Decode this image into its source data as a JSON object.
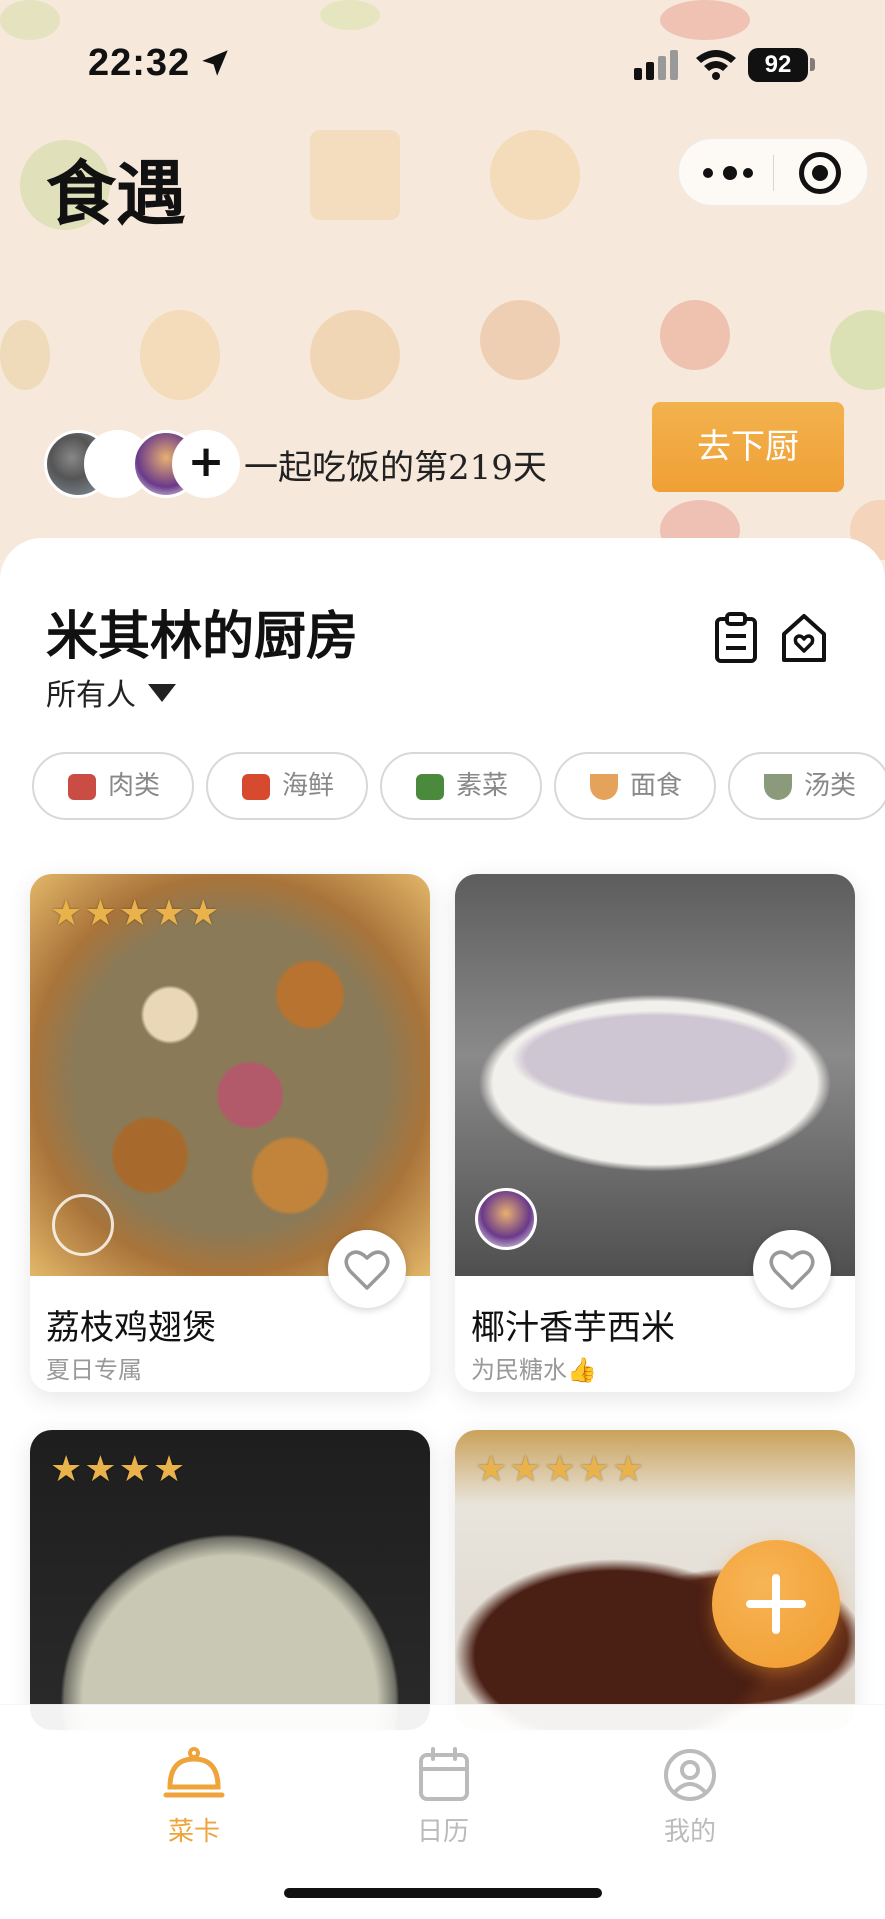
{
  "status_bar": {
    "time": "22:32",
    "battery": "92"
  },
  "app": {
    "title": "食遇"
  },
  "header": {
    "together_text": "一起吃饭的第219天",
    "cook_button": "去下厨"
  },
  "kitchen": {
    "title": "米其林的厨房",
    "owner_filter": "所有人"
  },
  "categories": [
    {
      "label": "肉类",
      "icon": "meat-icon",
      "color": "#c94d45"
    },
    {
      "label": "海鲜",
      "icon": "lobster-icon",
      "color": "#d64a2f"
    },
    {
      "label": "素菜",
      "icon": "leafy-greens-icon",
      "color": "#4b8a3c"
    },
    {
      "label": "面食",
      "icon": "noodle-bowl-icon",
      "color": "#e4a25b"
    },
    {
      "label": "汤类",
      "icon": "soup-bowl-icon",
      "color": "#8a9a7a"
    }
  ],
  "recipes": [
    {
      "name": "荔枝鸡翅煲",
      "subtitle": "夏日专属",
      "rating": 5,
      "favorited": false
    },
    {
      "name": "椰汁香芋西米",
      "subtitle": "为民糖水👍",
      "rating": 0,
      "favorited": false
    },
    {
      "name": "",
      "subtitle": "",
      "rating": 4,
      "favorited": false
    },
    {
      "name": "",
      "subtitle": "",
      "rating": 5,
      "favorited": false
    }
  ],
  "tabbar": {
    "items": [
      {
        "label": "菜卡",
        "icon": "service-bell-icon",
        "active": true
      },
      {
        "label": "日历",
        "icon": "calendar-icon",
        "active": false
      },
      {
        "label": "我的",
        "icon": "profile-icon",
        "active": false
      }
    ]
  },
  "colors": {
    "accent": "#eea33b",
    "star": "#e9b24a",
    "background": "#f6e9dc"
  }
}
